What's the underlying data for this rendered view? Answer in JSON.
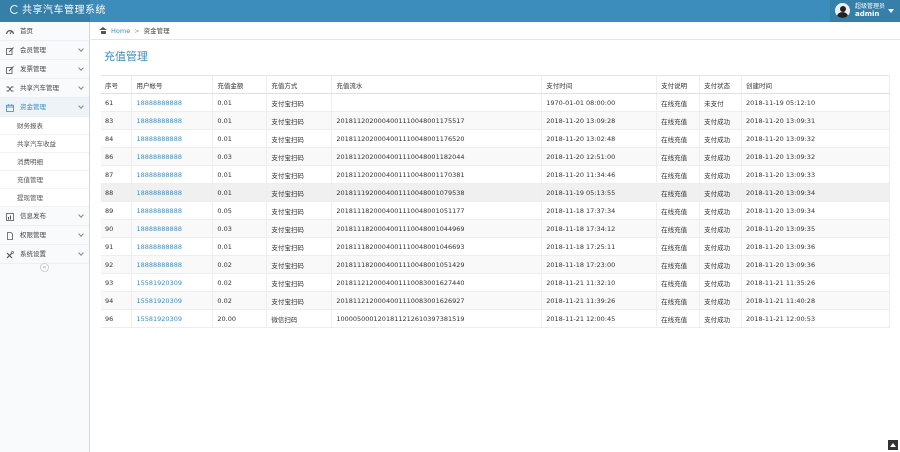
{
  "header": {
    "title": "共享汽车管理系统",
    "user_role": "超级管理员",
    "user_name": "admin"
  },
  "sidebar": {
    "items": [
      {
        "label": "首页",
        "icon": "dashboard-icon"
      },
      {
        "label": "会员管理",
        "icon": "edit-icon"
      },
      {
        "label": "发票管理",
        "icon": "edit-icon"
      },
      {
        "label": "共享汽车管理",
        "icon": "shuffle-icon"
      },
      {
        "label": "资金管理",
        "icon": "calendar-icon",
        "active": true
      },
      {
        "label": "信息发布",
        "icon": "bar-chart-icon"
      },
      {
        "label": "权限管理",
        "icon": "file-icon"
      },
      {
        "label": "系统设置",
        "icon": "tools-icon"
      }
    ],
    "sub_items": [
      "财务报表",
      "共享汽车收益",
      "消费明细",
      "充值管理",
      "提现管理"
    ]
  },
  "breadcrumb": {
    "home": "Home",
    "current": "资金管理"
  },
  "page_title": "充值管理",
  "table": {
    "columns": [
      "序号",
      "用户帐号",
      "充值金额",
      "充值方式",
      "充值流水",
      "支付时间",
      "支付说明",
      "支付状态",
      "创建时间"
    ],
    "rows": [
      [
        "61",
        "18888888888",
        "0.01",
        "支付宝扫码",
        "",
        "1970-01-01 08:00:00",
        "在线充值",
        "未支付",
        "2018-11-19 05:12:10"
      ],
      [
        "83",
        "18888888888",
        "0.01",
        "支付宝扫码",
        "2018112020004001110048001175517",
        "2018-11-20 13:09:28",
        "在线充值",
        "支付成功",
        "2018-11-20 13:09:31"
      ],
      [
        "84",
        "18888888888",
        "0.01",
        "支付宝扫码",
        "2018112020004001110048001176520",
        "2018-11-20 13:02:48",
        "在线充值",
        "支付成功",
        "2018-11-20 13:09:32"
      ],
      [
        "86",
        "18888888888",
        "0.03",
        "支付宝扫码",
        "2018112020004001110048001182044",
        "2018-11-20 12:51:00",
        "在线充值",
        "支付成功",
        "2018-11-20 13:09:32"
      ],
      [
        "87",
        "18888888888",
        "0.01",
        "支付宝扫码",
        "2018112020004001110048001170381",
        "2018-11-20 11:34:46",
        "在线充值",
        "支付成功",
        "2018-11-20 13:09:33"
      ],
      [
        "88",
        "18888888888",
        "0.01",
        "支付宝扫码",
        "2018111920004001110048001079538",
        "2018-11-19 05:13:55",
        "在线充值",
        "支付成功",
        "2018-11-20 13:09:34"
      ],
      [
        "89",
        "18888888888",
        "0.05",
        "支付宝扫码",
        "2018111820004001110048001051177",
        "2018-11-18 17:37:34",
        "在线充值",
        "支付成功",
        "2018-11-20 13:09:34"
      ],
      [
        "90",
        "18888888888",
        "0.03",
        "支付宝扫码",
        "2018111820004001110048001044969",
        "2018-11-18 17:34:12",
        "在线充值",
        "支付成功",
        "2018-11-20 13:09:35"
      ],
      [
        "91",
        "18888888888",
        "0.01",
        "支付宝扫码",
        "2018111820004001110048001046693",
        "2018-11-18 17:25:11",
        "在线充值",
        "支付成功",
        "2018-11-20 13:09:36"
      ],
      [
        "92",
        "18888888888",
        "0.02",
        "支付宝扫码",
        "2018111820004001110048001051429",
        "2018-11-18 17:23:00",
        "在线充值",
        "支付成功",
        "2018-11-20 13:09:36"
      ],
      [
        "93",
        "15581920309",
        "0.02",
        "支付宝扫码",
        "2018112120004001110083001627440",
        "2018-11-21 11:32:10",
        "在线充值",
        "支付成功",
        "2018-11-21 11:35:26"
      ],
      [
        "94",
        "15581920309",
        "0.02",
        "支付宝扫码",
        "2018112120004001110083001626927",
        "2018-11-21 11:39:26",
        "在线充值",
        "支付成功",
        "2018-11-21 11:40:28"
      ],
      [
        "96",
        "15581920309",
        "20.00",
        "微信扫码",
        "1000050001201811212610397381519",
        "2018-11-21 12:00:45",
        "在线充值",
        "支付成功",
        "2018-11-21 12:00:53"
      ]
    ]
  },
  "colors": {
    "header_bg": "#3c8dbc",
    "brand_bg": "#367fa9",
    "accent": "#3c8dbc",
    "sidebar_bg": "#f9fafc"
  }
}
